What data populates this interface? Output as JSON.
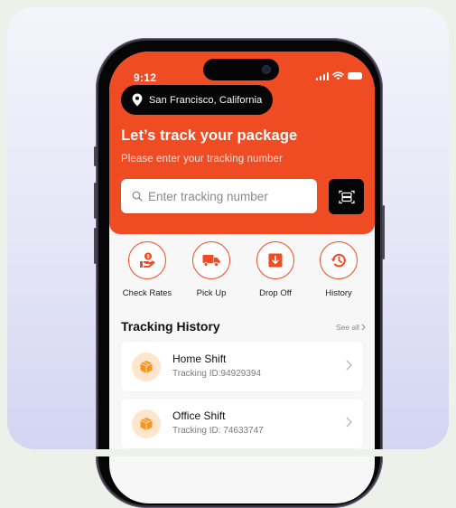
{
  "status_bar": {
    "time": "9:12",
    "icons": [
      "signal-icon",
      "wifi-icon",
      "battery-icon"
    ]
  },
  "location": {
    "icon": "location-pin-icon",
    "label": "San Francisco, California"
  },
  "header": {
    "title": "Let’s track your package",
    "subtitle": "Please enter your tracking number"
  },
  "search": {
    "icon": "search-icon",
    "placeholder": "Enter tracking number",
    "value": "",
    "scan_button_icon": "scan-icon"
  },
  "quick_actions": [
    {
      "label": "Check Rates",
      "icon": "hand-dollar-icon"
    },
    {
      "label": "Pick Up",
      "icon": "truck-icon"
    },
    {
      "label": "Drop Off",
      "icon": "download-box-icon"
    },
    {
      "label": "History",
      "icon": "history-clock-icon"
    }
  ],
  "tracking_history": {
    "title": "Tracking History",
    "see_all_label": "See all",
    "items": [
      {
        "title": "Home Shift",
        "subtitle": "Tracking ID:94929394",
        "icon": "package-icon"
      },
      {
        "title": "Office Shift",
        "subtitle": "Tracking ID: 74633747",
        "icon": "package-icon"
      }
    ]
  },
  "colors": {
    "brand_orange": "#ef4c24",
    "dark": "#050505",
    "package_bg": "#fde6cc",
    "package_icon": "#f7941d"
  }
}
